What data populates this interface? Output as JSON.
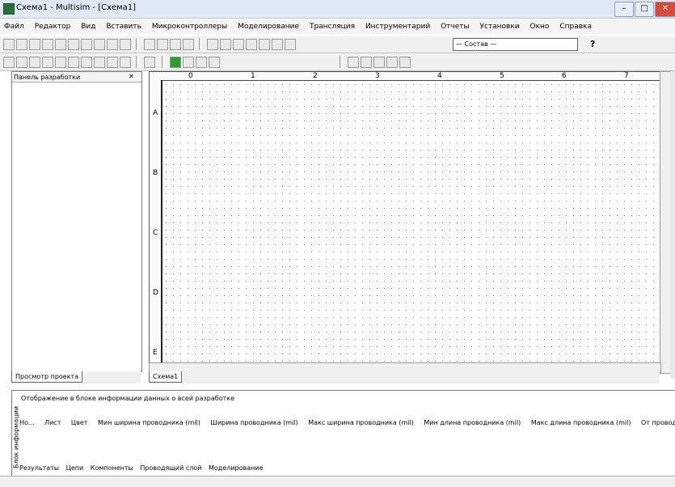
{
  "window": {
    "title": "Схема1 - Multisim - [Схема1]"
  },
  "menu": [
    "Файл",
    "Редактор",
    "Вид",
    "Вставить",
    "Микроконтроллеры",
    "Моделирование",
    "Трансляция",
    "Инструментарий",
    "Отчеты",
    "Установки",
    "Окно",
    "Справка"
  ],
  "toolbar": {
    "combo_value": "— Состав —",
    "help": "?"
  },
  "panel": {
    "title": "Панель разработки",
    "tab": "Просмотр проекта"
  },
  "canvas": {
    "tab": "Схема1",
    "rows": [
      "A",
      "B",
      "C",
      "D",
      "E"
    ],
    "cols": [
      "0",
      "1",
      "2",
      "3",
      "4",
      "5",
      "6",
      "7"
    ]
  },
  "bottom": {
    "title": "Отображение в блоке информации данных о всей разработке",
    "side_label": "Блок информации",
    "columns": [
      "Но...",
      "Лист",
      "Цвет",
      "Мин ширина проводника (mil)",
      "Ширина проводника (mil)",
      "Макс ширина проводника (mil)",
      "Мин длина проводника (mil)",
      "Макс длина проводника (mil)",
      "От провода"
    ],
    "tabs": [
      "Результаты",
      "Цепи",
      "Компоненты",
      "Проводящий слой",
      "Моделирование"
    ]
  }
}
